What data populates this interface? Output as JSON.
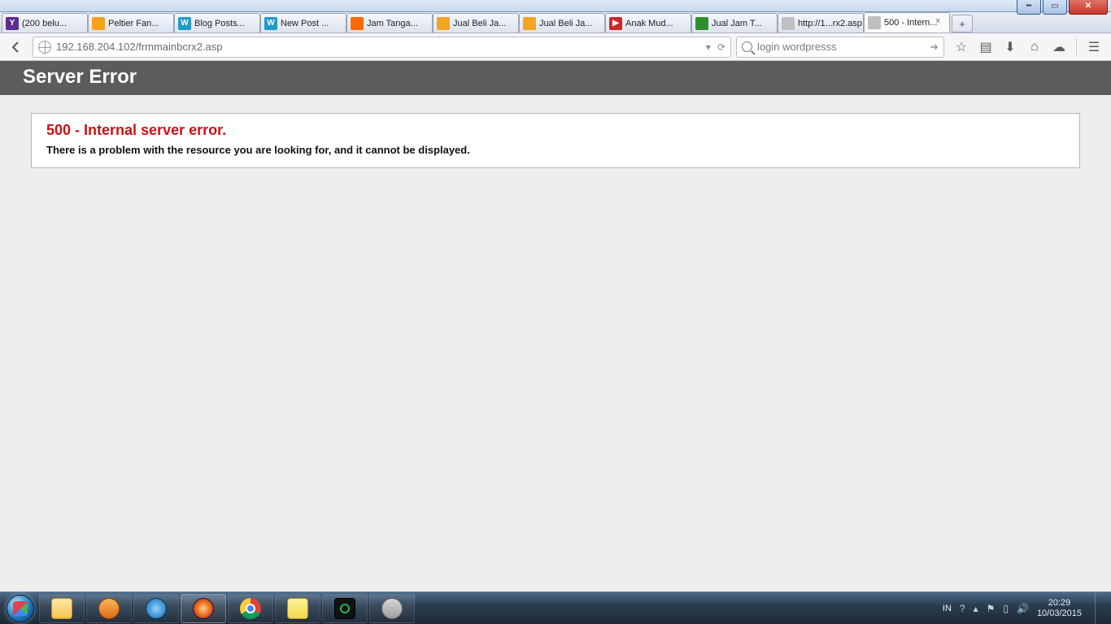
{
  "window": {
    "caption_buttons": [
      "min",
      "max",
      "close"
    ]
  },
  "tabs": [
    {
      "label": "(200 belu...",
      "fav_class": "fv-ymail",
      "fav_text": "Y"
    },
    {
      "label": "Peltier Fan...",
      "fav_class": "fv-peltier",
      "fav_text": ""
    },
    {
      "label": "Blog Posts...",
      "fav_class": "fv-wp",
      "fav_text": "W"
    },
    {
      "label": "New Post ...",
      "fav_class": "fv-wp",
      "fav_text": "W"
    },
    {
      "label": "Jam Tanga...",
      "fav_class": "fv-orange",
      "fav_text": ""
    },
    {
      "label": "Jual Beli Ja...",
      "fav_class": "fv-flame",
      "fav_text": ""
    },
    {
      "label": "Jual Beli Ja...",
      "fav_class": "fv-flame",
      "fav_text": ""
    },
    {
      "label": "Anak Mud...",
      "fav_class": "fv-yt",
      "fav_text": "▶"
    },
    {
      "label": "Jual Jam T...",
      "fav_class": "fv-toko",
      "fav_text": ""
    },
    {
      "label": "http://1...rx2.asp",
      "fav_class": "fv-none",
      "fav_text": ""
    },
    {
      "label": "500 - Intern...",
      "fav_class": "fv-none",
      "fav_text": "",
      "active": true
    }
  ],
  "nav": {
    "url": "192.168.204.102/frmmainbcrx2.asp",
    "search": "login wordpresss",
    "reader_hint": "▾",
    "reload_glyph": "⟳"
  },
  "page": {
    "banner": "Server Error",
    "code_line": "500 - Internal server error.",
    "message": "There is a problem with the resource you are looking for, and it cannot be displayed."
  },
  "taskbar": {
    "lang": "IN",
    "time": "20:29",
    "date": "10/03/2015"
  }
}
